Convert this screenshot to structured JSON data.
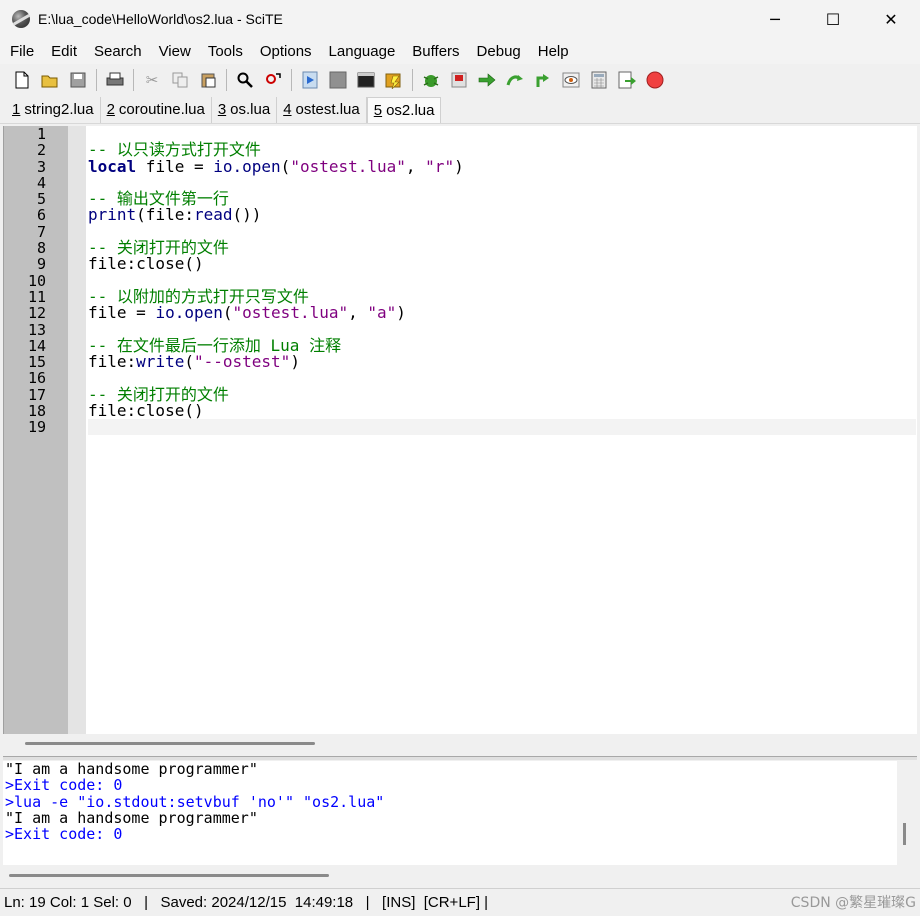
{
  "window": {
    "title": "E:\\lua_code\\HelloWorld\\os2.lua - SciTE",
    "minimize": "─",
    "maximize": "☐",
    "close": "✕"
  },
  "menu": [
    "File",
    "Edit",
    "Search",
    "View",
    "Tools",
    "Options",
    "Language",
    "Buffers",
    "Debug",
    "Help"
  ],
  "toolbar_icons": [
    "new-file-icon",
    "open-file-icon",
    "save-icon",
    "print-icon",
    "cut-icon",
    "copy-icon",
    "paste-icon",
    "find-icon",
    "replace-icon",
    "compile-icon",
    "stop-icon",
    "terminal-icon",
    "build-icon",
    "debug-icon",
    "breakpoint-icon",
    "step-icon",
    "step-over-icon",
    "step-out-icon",
    "watch-icon",
    "calculator-icon",
    "export-icon",
    "record-icon"
  ],
  "tabs": [
    {
      "num": "1",
      "label": "string2.lua",
      "active": false
    },
    {
      "num": "2",
      "label": "coroutine.lua",
      "active": false
    },
    {
      "num": "3",
      "label": "os.lua",
      "active": false
    },
    {
      "num": "4",
      "label": "ostest.lua",
      "active": false
    },
    {
      "num": "5",
      "label": "os2.lua",
      "active": true
    }
  ],
  "line_numbers": [
    "1",
    "2",
    "3",
    "4",
    "5",
    "6",
    "7",
    "8",
    "9",
    "10",
    "11",
    "12",
    "13",
    "14",
    "15",
    "16",
    "17",
    "18",
    "19"
  ],
  "code_lines": [
    [],
    [
      {
        "t": "-- 以只读方式打开文件",
        "c": "comment"
      }
    ],
    [
      {
        "t": "local",
        "c": "kw"
      },
      {
        "t": " file = ",
        "c": "op"
      },
      {
        "t": "io.open",
        "c": "fn"
      },
      {
        "t": "(",
        "c": "op"
      },
      {
        "t": "\"ostest.lua\"",
        "c": "str"
      },
      {
        "t": ", ",
        "c": "op"
      },
      {
        "t": "\"r\"",
        "c": "str"
      },
      {
        "t": ")",
        "c": "op"
      }
    ],
    [],
    [
      {
        "t": "-- 输出文件第一行",
        "c": "comment"
      }
    ],
    [
      {
        "t": "print",
        "c": "fn"
      },
      {
        "t": "(file:",
        "c": "op"
      },
      {
        "t": "read",
        "c": "fn"
      },
      {
        "t": "())",
        "c": "op"
      }
    ],
    [],
    [
      {
        "t": "-- 关闭打开的文件",
        "c": "comment"
      }
    ],
    [
      {
        "t": "file:close()",
        "c": "op"
      }
    ],
    [],
    [
      {
        "t": "-- 以附加的方式打开只写文件",
        "c": "comment"
      }
    ],
    [
      {
        "t": "file = ",
        "c": "op"
      },
      {
        "t": "io.open",
        "c": "fn"
      },
      {
        "t": "(",
        "c": "op"
      },
      {
        "t": "\"ostest.lua\"",
        "c": "str"
      },
      {
        "t": ", ",
        "c": "op"
      },
      {
        "t": "\"a\"",
        "c": "str"
      },
      {
        "t": ")",
        "c": "op"
      }
    ],
    [],
    [
      {
        "t": "-- 在文件最后一行添加 Lua 注释",
        "c": "comment"
      }
    ],
    [
      {
        "t": "file:",
        "c": "op"
      },
      {
        "t": "write",
        "c": "fn"
      },
      {
        "t": "(",
        "c": "op"
      },
      {
        "t": "\"--ostest\"",
        "c": "str"
      },
      {
        "t": ")",
        "c": "op"
      }
    ],
    [],
    [
      {
        "t": "-- 关闭打开的文件",
        "c": "comment"
      }
    ],
    [
      {
        "t": "file:close()",
        "c": "op"
      }
    ],
    []
  ],
  "output_lines": [
    {
      "t": "\"I am a handsome programmer\"",
      "cmd": false
    },
    {
      "t": ">Exit code: 0",
      "cmd": true
    },
    {
      "t": ">lua -e \"io.stdout:setvbuf 'no'\" \"os2.lua\"",
      "cmd": true
    },
    {
      "t": "\"I am a handsome programmer\"",
      "cmd": false
    },
    {
      "t": ">Exit code: 0",
      "cmd": true
    }
  ],
  "status": {
    "text": "Ln: 19 Col: 1 Sel: 0   |   Saved: 2024/12/15  14:49:18   |   [INS]  [CR+LF] |"
  },
  "watermark": "CSDN @繁星璀璨G"
}
